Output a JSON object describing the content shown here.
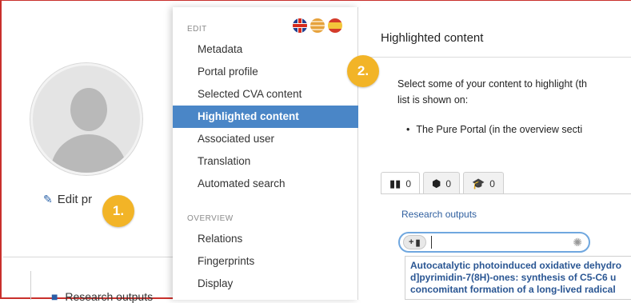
{
  "background": {
    "edit_profile": "Edit pr",
    "research_outputs": "Research outputs"
  },
  "badges": {
    "one": "1.",
    "two": "2."
  },
  "menu": {
    "edit_heading": "EDIT",
    "overview_heading": "OVERVIEW",
    "edit_items": [
      {
        "label": "Metadata",
        "active": false
      },
      {
        "label": "Portal profile",
        "active": false
      },
      {
        "label": "Selected CVA content",
        "active": false
      },
      {
        "label": "Highlighted content",
        "active": true
      },
      {
        "label": "Associated user",
        "active": false
      },
      {
        "label": "Translation",
        "active": false
      },
      {
        "label": "Automated search",
        "active": false
      }
    ],
    "overview_items": [
      {
        "label": "Relations"
      },
      {
        "label": "Fingerprints"
      },
      {
        "label": "Display"
      }
    ],
    "flag_icons": [
      "uk-flag-icon",
      "striped-flag-icon",
      "spain-flag-icon"
    ]
  },
  "panel": {
    "title": "Highlighted content",
    "description_line1": "Select some of your content to highlight (th",
    "description_line2": "list is shown on:",
    "bullet": "The Pure Portal (in the overview secti",
    "tabs": [
      {
        "icon": "book-icon",
        "count": "0"
      },
      {
        "icon": "cube-icon",
        "count": "0"
      },
      {
        "icon": "graduation-cap-icon",
        "count": "0"
      }
    ],
    "section_label": "Research outputs",
    "add_button_label": "+",
    "search_value": "",
    "results": [
      "Autocatalytic photoinduced oxidative dehydro",
      "d]pyrimidin-7(8H)-ones: synthesis of C5-C6 u",
      "concomitant formation of a long-lived radical"
    ]
  },
  "colors": {
    "accent": "#4a86c7",
    "badge": "#f2b427",
    "link": "#2a5693",
    "frame": "#c9302c"
  }
}
